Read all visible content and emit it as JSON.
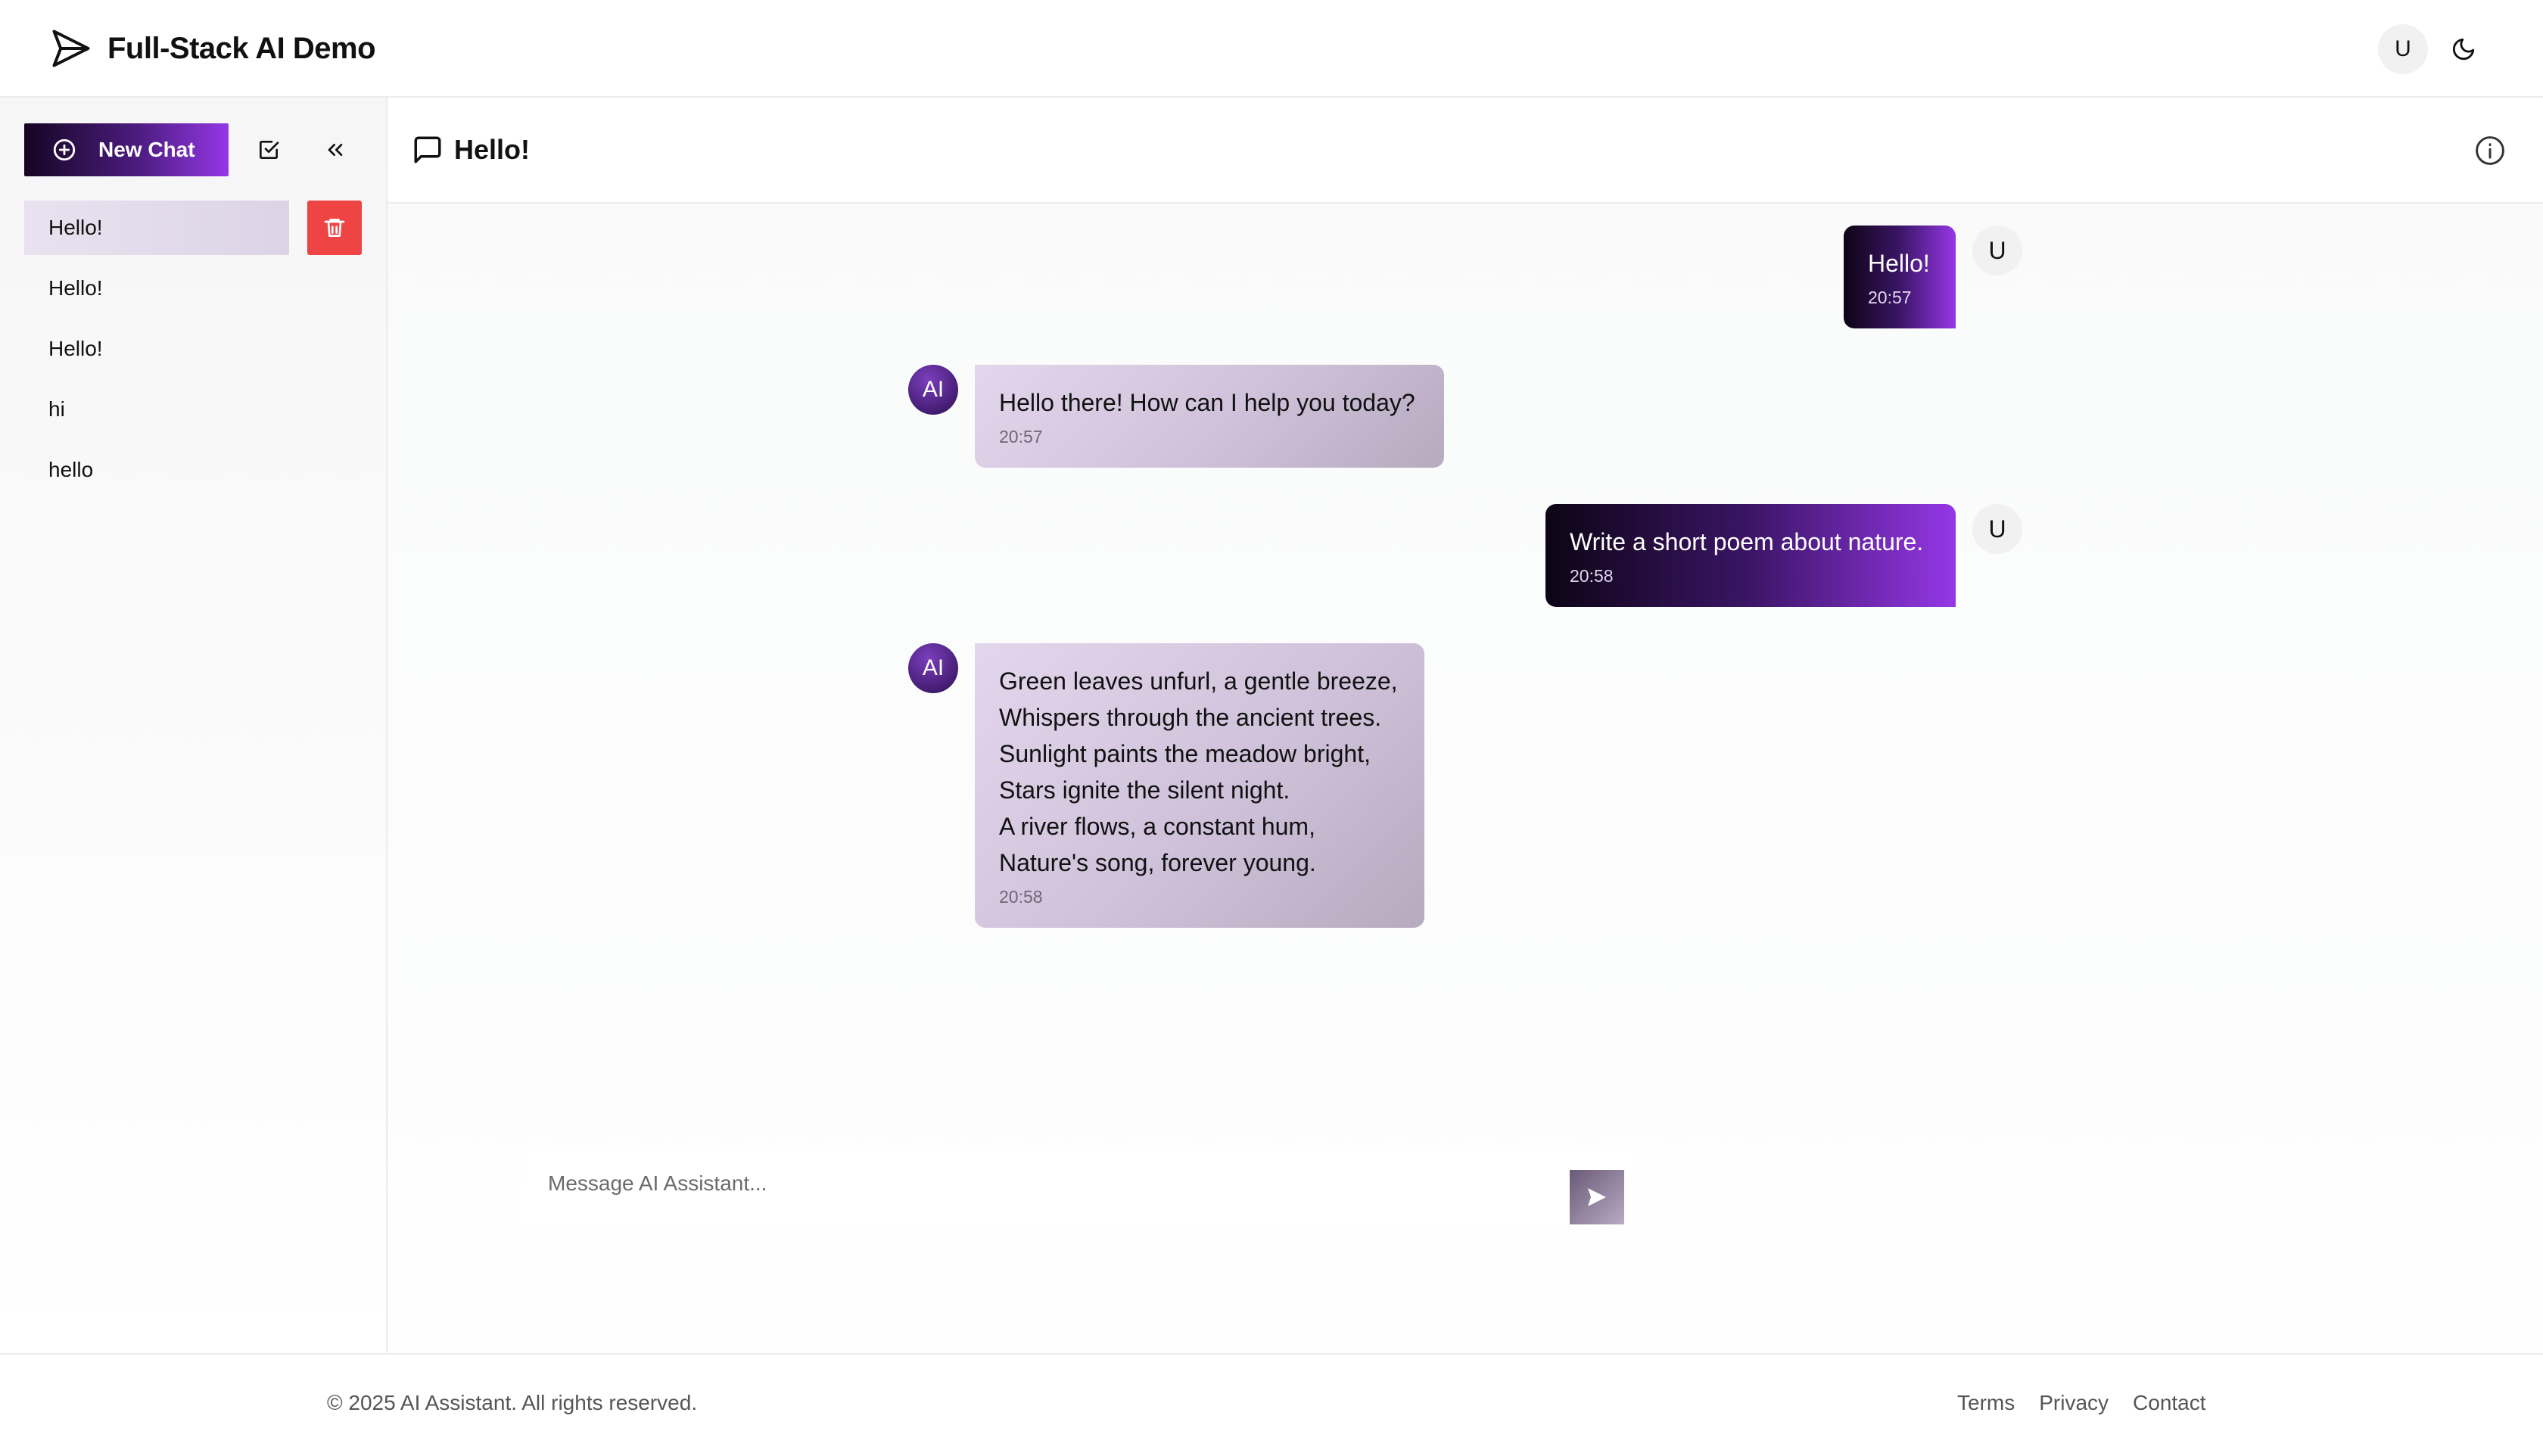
{
  "app": {
    "title": "Full-Stack AI Demo",
    "user_initial": "U",
    "icons": {
      "logo": "send-arrow-icon",
      "theme": "moon-icon"
    }
  },
  "sidebar": {
    "new_chat_label": "New Chat",
    "chats": [
      {
        "label": "Hello!",
        "active": true
      },
      {
        "label": "Hello!"
      },
      {
        "label": "Hello!"
      },
      {
        "label": "hi"
      },
      {
        "label": "hello"
      }
    ]
  },
  "chat": {
    "title": "Hello!",
    "messages": [
      {
        "role": "user",
        "avatar": "U",
        "text": "Hello!",
        "time": "20:57"
      },
      {
        "role": "ai",
        "avatar": "AI",
        "text": "Hello there! How can I help you today?",
        "time": "20:57"
      },
      {
        "role": "user",
        "avatar": "U",
        "text": "Write a short poem about nature.",
        "time": "20:58"
      },
      {
        "role": "ai",
        "avatar": "AI",
        "text": "Green leaves unfurl, a gentle breeze,\nWhispers through the ancient trees.\nSunlight paints the meadow bright,\nStars ignite the silent night.\nA river flows, a constant hum,\nNature's song, forever young.",
        "time": "20:58"
      }
    ]
  },
  "composer": {
    "placeholder": "Message AI Assistant..."
  },
  "footer": {
    "copyright": "© 2025 AI Assistant. All rights reserved.",
    "links": [
      "Terms",
      "Privacy",
      "Contact"
    ]
  },
  "colors": {
    "accent_dark": "#150522",
    "accent_light": "#9537e6",
    "delete": "#ef4444"
  }
}
